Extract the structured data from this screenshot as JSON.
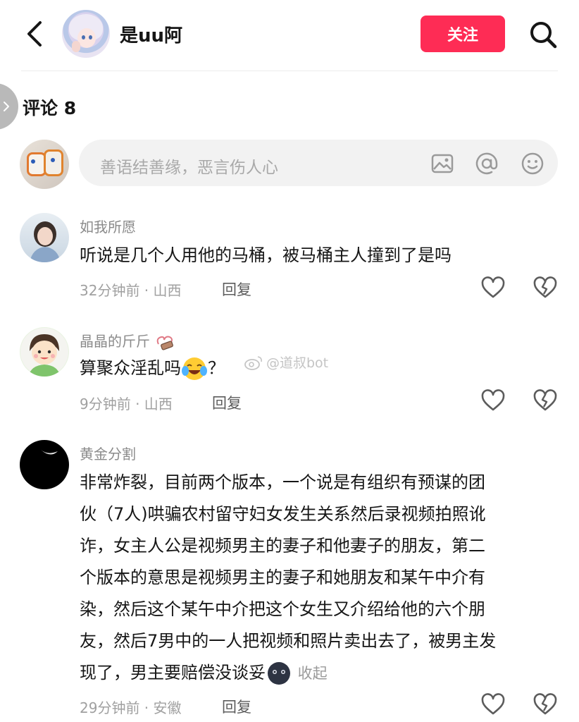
{
  "header": {
    "username": "是uu阿",
    "follow_label": "关注"
  },
  "comments_section": {
    "title": "评论 8",
    "input_placeholder": "善语结善缘，恶言伤人心"
  },
  "comments": [
    {
      "name": "如我所愿",
      "text": "听说是几个人用他的马桶，被马桶主人撞到了是吗",
      "meta": "32分钟前 · 山西",
      "reply_label": "回复"
    },
    {
      "name": "晶晶的斤斤",
      "text": "算聚众淫乱吗",
      "text_suffix": "？",
      "meta": "9分钟前 · 山西",
      "reply_label": "回复"
    },
    {
      "name": "黄金分割",
      "lines": [
        "非常炸裂，目前两个版本，一个说是有组织有预谋的团",
        "伙（7人)哄骗农村留守妇女发生关系然后录视频拍照讹",
        "诈，女主人公是视频男主的妻子和他妻子的朋友，第二",
        "个版本的意思是视频男主的妻子和她朋友和某午中介有",
        "染，然后这个某午中介把这个女生又介绍给他的六个朋",
        "友，然后7男中的一人把视频和照片卖出去了，被男主发",
        "现了，男主要赔偿没谈妥"
      ],
      "collapse_label": "收起",
      "meta": "29分钟前 · 安徽",
      "reply_label": "回复"
    }
  ],
  "watermark": "@道叔bot",
  "colors": {
    "accent": "#fe2c55",
    "text_primary": "#161616",
    "text_secondary": "#8a8a8a"
  }
}
